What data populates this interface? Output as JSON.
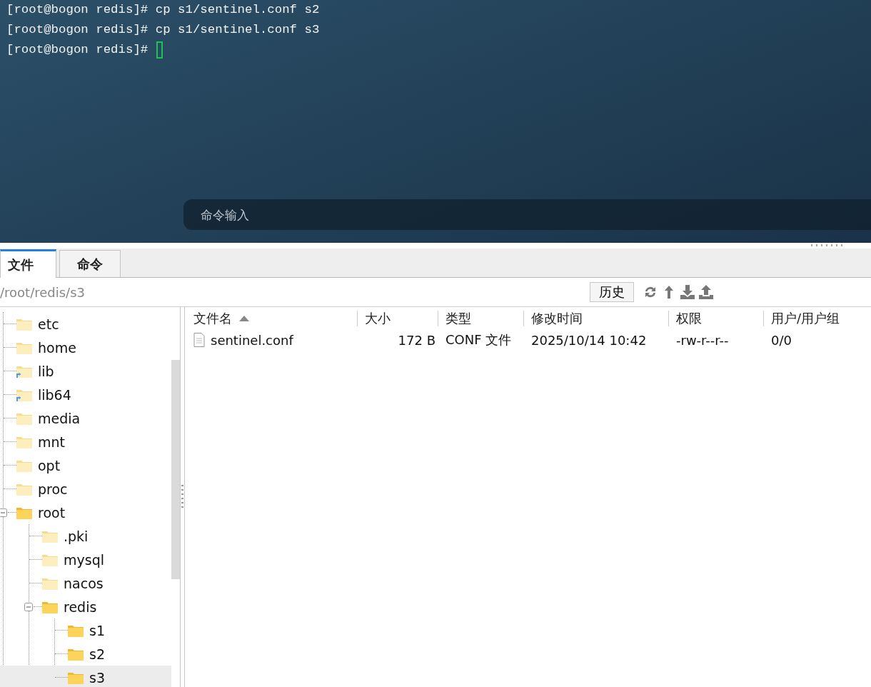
{
  "terminal": {
    "lines": [
      "[root@bogon redis]# cp s1/sentinel.conf s2",
      "[root@bogon redis]# cp s1/sentinel.conf s3",
      "[root@bogon redis]# "
    ],
    "command_input": {
      "placeholder": "命令输入"
    }
  },
  "tabs": [
    {
      "label": "文件",
      "selected": true
    },
    {
      "label": "命令",
      "selected": false
    }
  ],
  "path_bar": {
    "path": "/root/redis/s3",
    "history_button": "历史"
  },
  "tree": [
    {
      "label": "etc",
      "kind": "plain",
      "selected": false
    },
    {
      "label": "home",
      "kind": "plain",
      "selected": false
    },
    {
      "label": "lib",
      "kind": "link",
      "selected": false
    },
    {
      "label": "lib64",
      "kind": "link",
      "selected": false
    },
    {
      "label": "media",
      "kind": "plain",
      "selected": false
    },
    {
      "label": "mnt",
      "kind": "plain",
      "selected": false
    },
    {
      "label": "opt",
      "kind": "plain",
      "selected": false
    },
    {
      "label": "proc",
      "kind": "plain",
      "selected": false
    },
    {
      "label": "root",
      "kind": "loaded",
      "selected": false,
      "expanded": true,
      "children": [
        {
          "label": ".pki",
          "kind": "plain",
          "selected": false
        },
        {
          "label": "mysql",
          "kind": "plain",
          "selected": false
        },
        {
          "label": "nacos",
          "kind": "plain",
          "selected": false
        },
        {
          "label": "redis",
          "kind": "loaded",
          "selected": false,
          "expanded": true,
          "children": [
            {
              "label": "s1",
              "kind": "loaded",
              "selected": false
            },
            {
              "label": "s2",
              "kind": "loaded",
              "selected": false
            },
            {
              "label": "s3",
              "kind": "loaded",
              "selected": true
            }
          ]
        }
      ]
    }
  ],
  "file_table": {
    "columns": [
      {
        "label": "文件名",
        "sorted": true
      },
      {
        "label": "大小",
        "sorted": false
      },
      {
        "label": "类型",
        "sorted": false
      },
      {
        "label": "修改时间",
        "sorted": false
      },
      {
        "label": "权限",
        "sorted": false
      },
      {
        "label": "用户/用户组",
        "sorted": false
      }
    ],
    "rows": [
      {
        "name": "sentinel.conf",
        "size": "172 B",
        "type": "CONF 文件",
        "modified": "2025/10/14 10:42",
        "permissions": "-rw-r--r--",
        "owner": "0/0"
      }
    ]
  }
}
